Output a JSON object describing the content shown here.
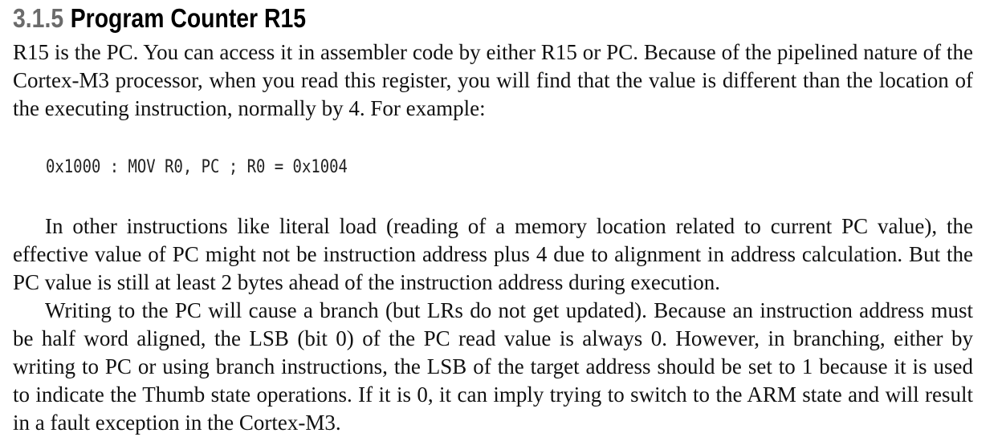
{
  "section": {
    "number": "3.1.5",
    "title": "Program Counter R15"
  },
  "paragraphs": [
    "R15 is the PC. You can access it in assembler code by either R15 or PC. Because of the pipelined nature of the Cortex-M3 processor, when you read this register, you will find that the value is different than the location of the executing instruction, normally by 4. For example:",
    "In other instructions like literal load (reading of a memory location related to current PC value), the effective value of PC might not be instruction address plus 4 due to alignment in address calculation. But the PC value is still at least 2 bytes ahead of the instruction address during execution.",
    "Writing to the PC will cause a branch (but LRs do not get updated). Because an instruction address must be half word aligned, the LSB (bit 0) of the PC read value is always 0. However, in branching, either by writing to PC or using branch instructions, the LSB of the target address should be set to 1 because it is used to indicate the Thumb state operations. If it is 0, it can imply trying to switch to the ARM state and will result in a fault exception in the Cortex-M3."
  ],
  "code_example": "0x1000 : MOV R0, PC ; R0 = 0x1004"
}
